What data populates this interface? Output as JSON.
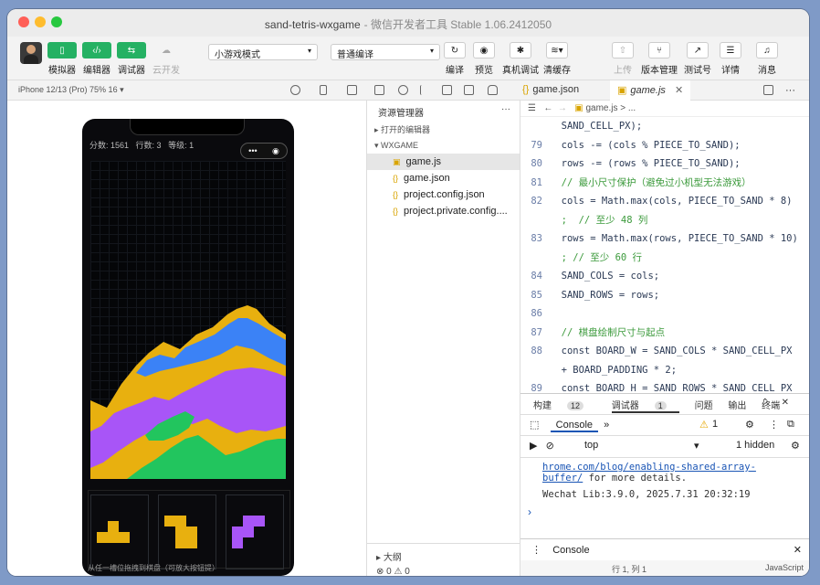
{
  "window": {
    "title": "sand-tetris-wxgame",
    "subtitle": "- 微信开发者工具 Stable 1.06.2412050"
  },
  "toolbar": {
    "simulator": "模拟器",
    "editor": "编辑器",
    "debugger": "调试器",
    "cloud": "云开发",
    "mode_select": "小游戏模式",
    "compile_select": "普通编译",
    "compile": "编译",
    "preview": "预览",
    "real_debug": "真机调试",
    "clear_cache": "清缓存",
    "upload": "上传",
    "version": "版本管理",
    "test_account": "测试号",
    "details": "详情",
    "messages": "消息"
  },
  "device": {
    "label": "iPhone 12/13 (Pro) 75% 16 ▾"
  },
  "tabs": [
    {
      "label": "game.json"
    },
    {
      "label": "game.js"
    }
  ],
  "game": {
    "score": "分数: 1561",
    "lines": "行数: 3",
    "level": "等级: 1",
    "capsule_more": "•••",
    "capsule_close": "◉",
    "hint": "从任一槽位拖拽到棋盘（可放大按钮提）"
  },
  "tree": {
    "header": "资源管理器",
    "more": "···",
    "open_editors": "打开的编辑器",
    "project": "WXGAME",
    "files": [
      "game.js",
      "game.json",
      "project.config.json",
      "project.private.config...."
    ],
    "outline": "大纲",
    "problems": "⊗ 0  ⚠ 0"
  },
  "breadcrumb": {
    "file": "game.js",
    "rest": "> ..."
  },
  "code": [
    {
      "n": "",
      "t": "  SAND_CELL_PX);"
    },
    {
      "n": "79",
      "t": "  cols -= (cols % PIECE_TO_SAND);"
    },
    {
      "n": "80",
      "t": "  rows -= (rows % PIECE_TO_SAND);"
    },
    {
      "n": "81",
      "t": "  // 最小尺寸保护（避免过小机型无法游戏）"
    },
    {
      "n": "82",
      "t": "  cols = Math.max(cols, PIECE_TO_SAND * 8)"
    },
    {
      "n": "",
      "t": "  ;  // 至少 48 列"
    },
    {
      "n": "83",
      "t": "  rows = Math.max(rows, PIECE_TO_SAND * 10)"
    },
    {
      "n": "",
      "t": "  ; // 至少 60 行"
    },
    {
      "n": "84",
      "t": "  SAND_COLS = cols;"
    },
    {
      "n": "85",
      "t": "  SAND_ROWS = rows;"
    },
    {
      "n": "86",
      "t": ""
    },
    {
      "n": "87",
      "t": "  // 棋盘绘制尺寸与起点"
    },
    {
      "n": "88",
      "t": "  const BOARD_W = SAND_COLS * SAND_CELL_PX"
    },
    {
      "n": "",
      "t": "  + BOARD_PADDING * 2;"
    },
    {
      "n": "89",
      "t": "  const BOARD_H = SAND_ROWS * SAND_CELL_PX"
    }
  ],
  "console": {
    "build": "构建",
    "build_count": "12",
    "debugger": "调试器",
    "debugger_count": "1",
    "issues": "问题",
    "output": "输出",
    "terminal": "终端",
    "tab": "Console",
    "warn_count": "1",
    "context": "top",
    "hidden": "1 hidden",
    "log_link": "hrome.com/blog/enabling-shared-array-buffer/",
    "log_tail": " for more details.",
    "log2": "Wechat Lib:3.9.0, 2025.7.31 20:32:19",
    "prompt": "›",
    "drawer": "Console",
    "status": "行 1, 列 1",
    "lang": "JavaScript"
  },
  "colors": {
    "yellow": "#e8b00f",
    "blue": "#3b82f6",
    "purple": "#a855f7",
    "green": "#22c55e"
  }
}
